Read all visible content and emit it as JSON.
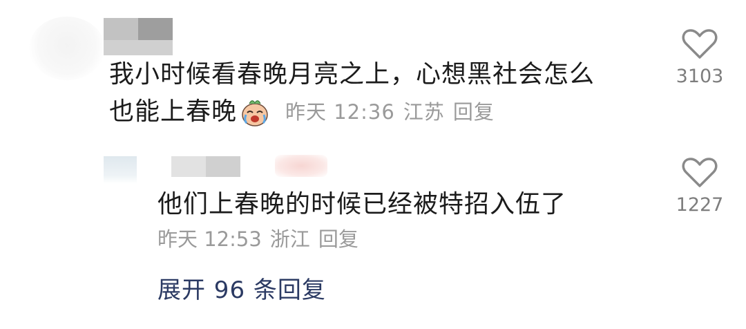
{
  "comment": {
    "text_line1": "我小时候看春晚月亮之上，心想黑社会怎么",
    "text_line2": "也能上春晚",
    "time": "昨天 12:36",
    "location": "江苏",
    "reply_label": "回复",
    "likes": "3103",
    "emoji_icon": "crying-laughing-emoji"
  },
  "reply": {
    "text": "他们上春晚的时候已经被特招入伍了",
    "time": "昨天 12:53",
    "location": "浙江",
    "reply_label": "回复",
    "likes": "1227"
  },
  "expand_label": "展开 96 条回复",
  "colors": {
    "text": "#1b1b1b",
    "meta": "#9a9a9a",
    "link": "#2b3a63",
    "icon": "#8a8a8a"
  }
}
